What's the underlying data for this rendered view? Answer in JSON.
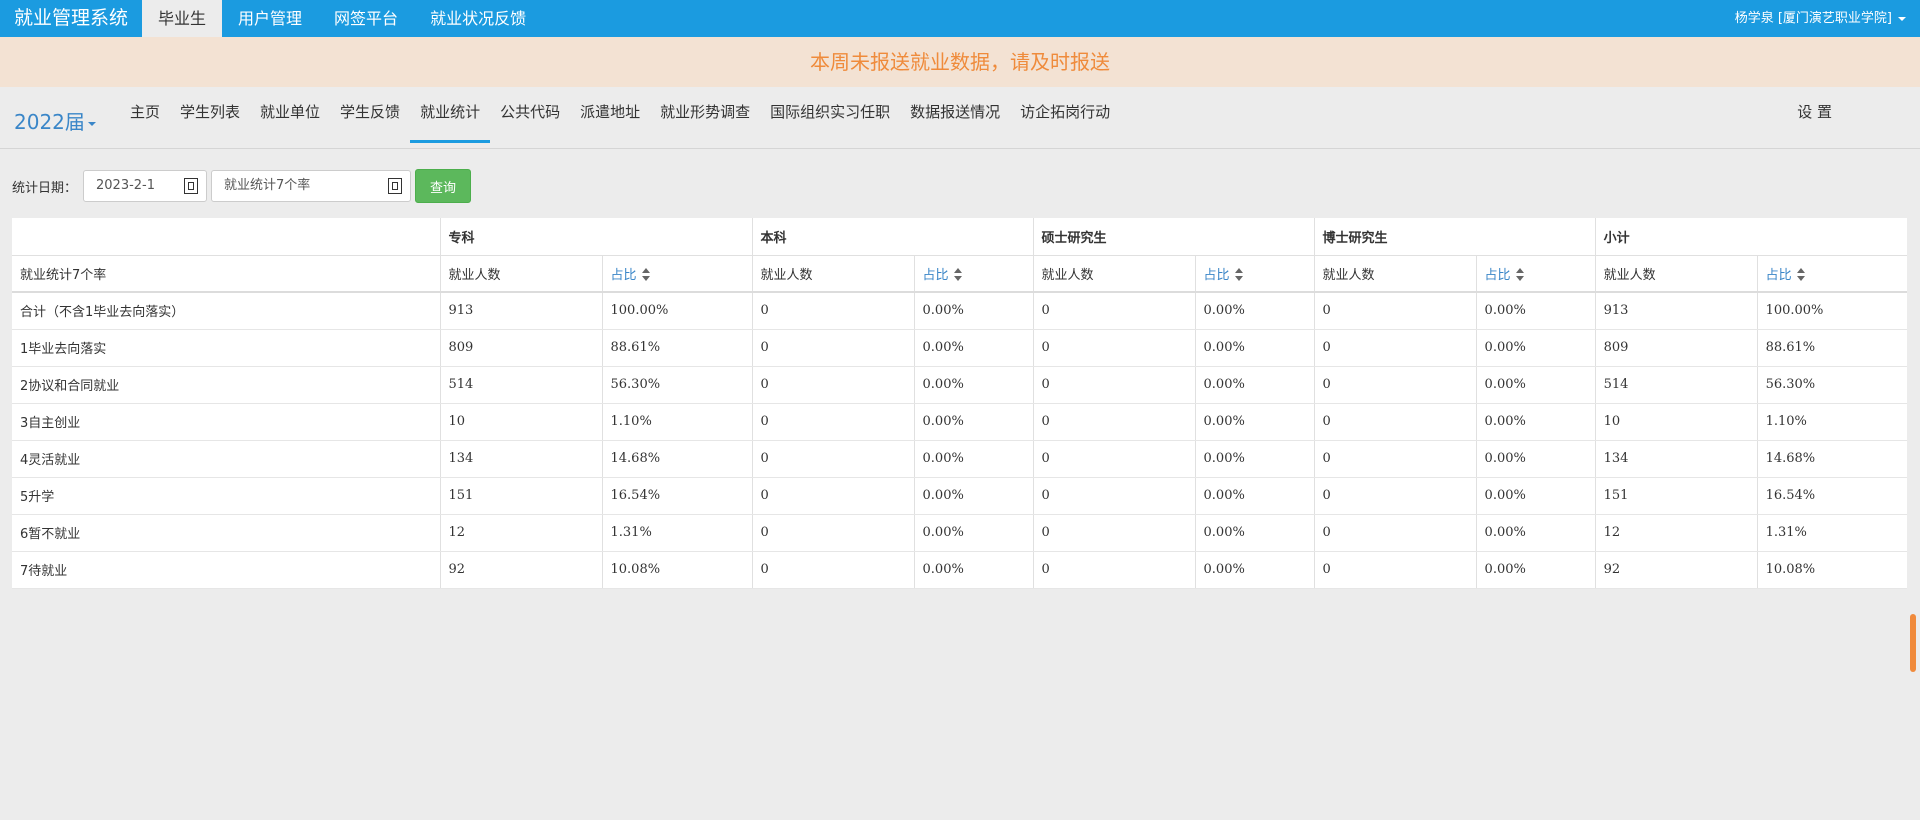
{
  "app": {
    "brand": "就业管理系统",
    "top_nav": [
      "毕业生",
      "用户管理",
      "网签平台",
      "就业状况反馈"
    ],
    "user": "杨学泉 [厦门演艺职业学院]"
  },
  "notice": "本周未报送就业数据，请及时报送",
  "subnav": {
    "year": "2022届",
    "items": [
      "主页",
      "学生列表",
      "就业单位",
      "学生反馈",
      "就业统计",
      "公共代码",
      "派遣地址",
      "就业形势调查",
      "国际组织实习任职",
      "数据报送情况",
      "访企拓岗行动"
    ],
    "settings": "设 置"
  },
  "filter": {
    "label": "统计日期：",
    "date": "2023-2-1",
    "type": "就业统计7个率",
    "query": "查询"
  },
  "table": {
    "row_header": "就业统计7个率",
    "groups": [
      "专科",
      "本科",
      "硕士研究生",
      "博士研究生",
      "小计"
    ],
    "sub": [
      "就业人数",
      "占比"
    ],
    "rows": [
      {
        "label": "合计（不含1毕业去向落实）",
        "cells": [
          "913",
          "100.00%",
          "0",
          "0.00%",
          "0",
          "0.00%",
          "0",
          "0.00%",
          "913",
          "100.00%"
        ]
      },
      {
        "label": "1毕业去向落实",
        "cells": [
          "809",
          "88.61%",
          "0",
          "0.00%",
          "0",
          "0.00%",
          "0",
          "0.00%",
          "809",
          "88.61%"
        ]
      },
      {
        "label": "2协议和合同就业",
        "cells": [
          "514",
          "56.30%",
          "0",
          "0.00%",
          "0",
          "0.00%",
          "0",
          "0.00%",
          "514",
          "56.30%"
        ]
      },
      {
        "label": "3自主创业",
        "cells": [
          "10",
          "1.10%",
          "0",
          "0.00%",
          "0",
          "0.00%",
          "0",
          "0.00%",
          "10",
          "1.10%"
        ]
      },
      {
        "label": "4灵活就业",
        "cells": [
          "134",
          "14.68%",
          "0",
          "0.00%",
          "0",
          "0.00%",
          "0",
          "0.00%",
          "134",
          "14.68%"
        ]
      },
      {
        "label": "5升学",
        "cells": [
          "151",
          "16.54%",
          "0",
          "0.00%",
          "0",
          "0.00%",
          "0",
          "0.00%",
          "151",
          "16.54%"
        ]
      },
      {
        "label": "6暂不就业",
        "cells": [
          "12",
          "1.31%",
          "0",
          "0.00%",
          "0",
          "0.00%",
          "0",
          "0.00%",
          "12",
          "1.31%"
        ]
      },
      {
        "label": "7待就业",
        "cells": [
          "92",
          "10.08%",
          "0",
          "0.00%",
          "0",
          "0.00%",
          "0",
          "0.00%",
          "92",
          "10.08%"
        ]
      }
    ]
  }
}
